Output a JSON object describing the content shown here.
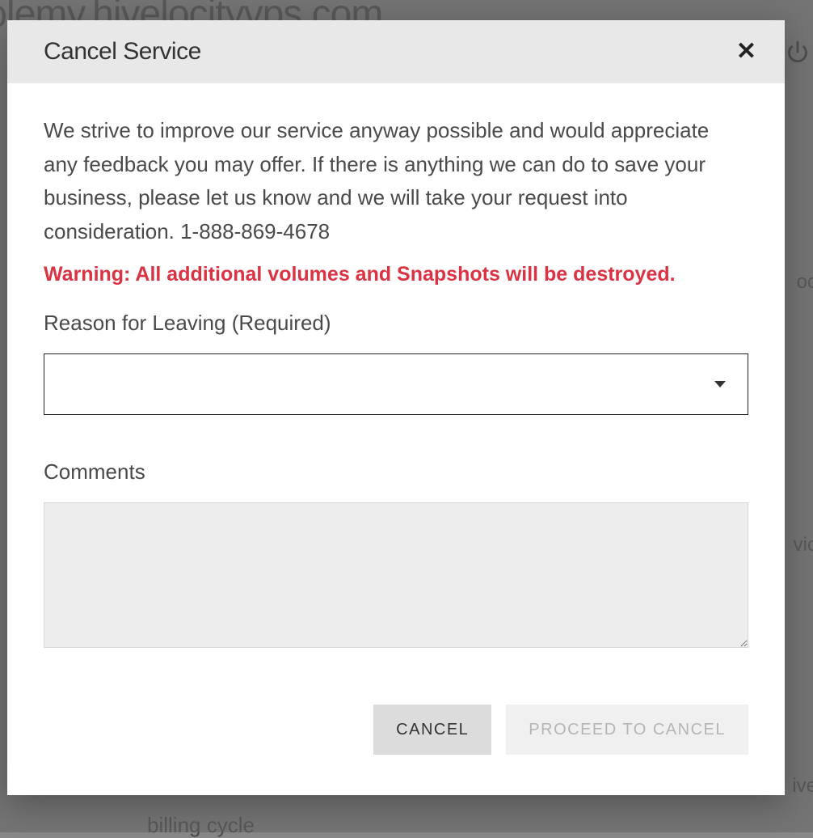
{
  "background": {
    "url_fragment": "tolemy.hivelocityvps.com",
    "text1": "oc",
    "text2": "vic",
    "text3": "ive",
    "text4": "billing cycle"
  },
  "modal": {
    "title": "Cancel Service",
    "intro": "We strive to improve our service anyway possible and would appreciate any feedback you may offer. If there is anything we can do to save your business, please let us know and we will take your request into consideration. 1-888-869-4678",
    "warning": "Warning: All additional volumes and Snapshots will be destroyed.",
    "reason_label": "Reason for Leaving (Required)",
    "reason_value": "",
    "comments_label": "Comments",
    "comments_value": "",
    "buttons": {
      "cancel": "CANCEL",
      "proceed": "PROCEED TO CANCEL"
    }
  }
}
